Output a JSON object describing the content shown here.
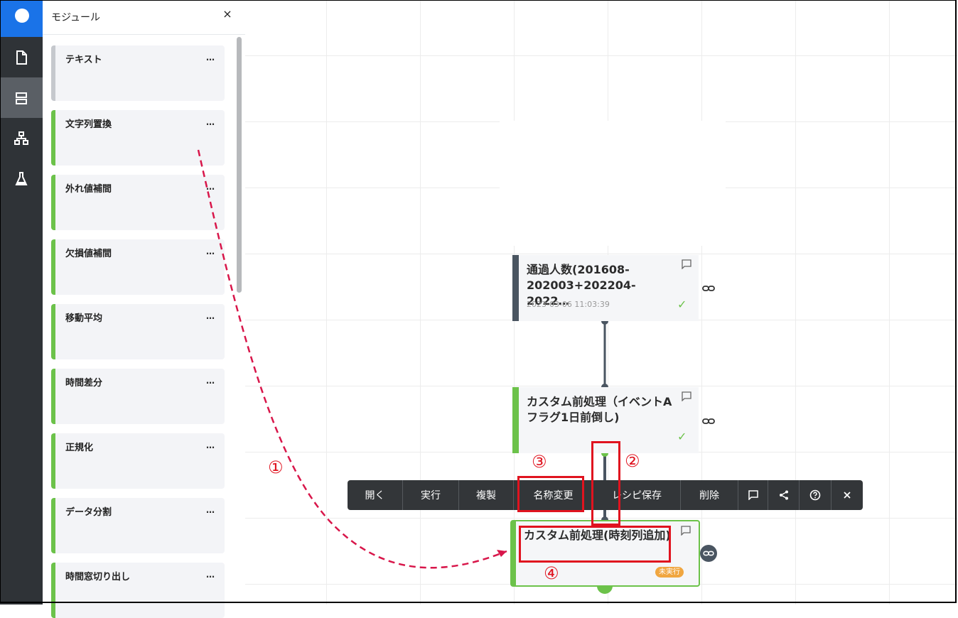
{
  "sidebar": {
    "icons": [
      "app-logo",
      "document-icon",
      "module-list-icon",
      "hierarchy-icon",
      "flask-icon"
    ]
  },
  "panel": {
    "title": "モジュール",
    "close": "×",
    "more": "…",
    "cards": [
      {
        "label": "テキスト",
        "accent": "#c5c8cd"
      },
      {
        "label": "文字列置換",
        "accent": "#6cc24a"
      },
      {
        "label": "外れ値補間",
        "accent": "#6cc24a"
      },
      {
        "label": "欠損値補間",
        "accent": "#6cc24a"
      },
      {
        "label": "移動平均",
        "accent": "#6cc24a"
      },
      {
        "label": "時間差分",
        "accent": "#6cc24a"
      },
      {
        "label": "正規化",
        "accent": "#6cc24a"
      },
      {
        "label": "データ分割",
        "accent": "#6cc24a"
      },
      {
        "label": "時間窓切り出し",
        "accent": "#6cc24a"
      }
    ]
  },
  "nodes": [
    {
      "title": "通過人数(201608-202003+202204-2022…",
      "time": "2023-03-06 11:03:39",
      "status": "done"
    },
    {
      "title": "カスタム前処理（イベントAフラグ1日前倒し)",
      "status": "done"
    },
    {
      "title": "カスタム前処理(時刻列追加)",
      "badge": "未実行"
    }
  ],
  "toolbar": {
    "open": "開く",
    "run": "実行",
    "duplicate": "複製",
    "rename": "名称変更",
    "save_recipe": "レシピ保存",
    "delete": "削除"
  },
  "annotations": {
    "n1": "①",
    "n2": "②",
    "n3": "③",
    "n4": "④"
  },
  "colors": {
    "accent_green": "#6cc24a",
    "annotation_red": "#e0131f",
    "brand_blue": "#1a73e8",
    "badge_orange": "#f0a640"
  }
}
